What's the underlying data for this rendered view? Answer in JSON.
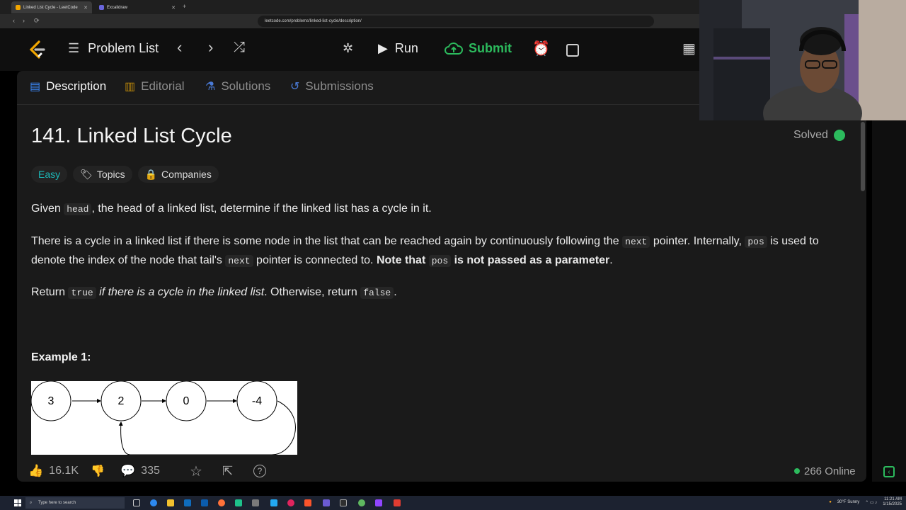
{
  "browser": {
    "tabs": [
      {
        "label": "Linked List Cycle - LeetCode",
        "active": true
      },
      {
        "label": "Excalidraw",
        "active": false
      }
    ],
    "url": "leetcode.com/problems/linked-list-cycle/description/"
  },
  "header": {
    "problem_list": "Problem List",
    "run": "Run",
    "submit": "Submit"
  },
  "tabs": [
    {
      "label": "Description"
    },
    {
      "label": "Editorial"
    },
    {
      "label": "Solutions"
    },
    {
      "label": "Submissions"
    }
  ],
  "problem": {
    "title": "141. Linked List Cycle",
    "status": "Solved",
    "difficulty": "Easy",
    "topics": "Topics",
    "companies": "Companies",
    "p1": {
      "a": "Given",
      "code": "head",
      "b": ", the head of a linked list, determine if the linked list has a cycle in it."
    },
    "p2": {
      "a": "There is a cycle in a linked list if there is some node in the list that can be reached again by continuously following the",
      "c1": "next",
      "b": "pointer. Internally,",
      "c2": "pos",
      "c": "is used to denote the index of the node that tail's",
      "c3": "next",
      "d": "pointer is connected to.",
      "bold1": "Note that",
      "c4": "pos",
      "bold2": "is not passed as a parameter",
      "end": "."
    },
    "p3": {
      "a": "Return",
      "c1": "true",
      "italic": "if there is a cycle in the linked list",
      "b": ". Otherwise, return",
      "c2": "false",
      "end": "."
    },
    "example_title": "Example 1:",
    "nodes": [
      "3",
      "2",
      "0",
      "-4"
    ]
  },
  "footer": {
    "likes": "16.1K",
    "comments": "335",
    "online": "266 Online"
  },
  "taskbar": {
    "search_placeholder": "Type here to search",
    "weather": "30°F Sunny",
    "time": "11:21 AM",
    "date": "1/15/2025"
  },
  "colors": {
    "accent_green": "#2cbb5d",
    "easy": "#1cb8b8",
    "bg": "#1a1a1a"
  }
}
